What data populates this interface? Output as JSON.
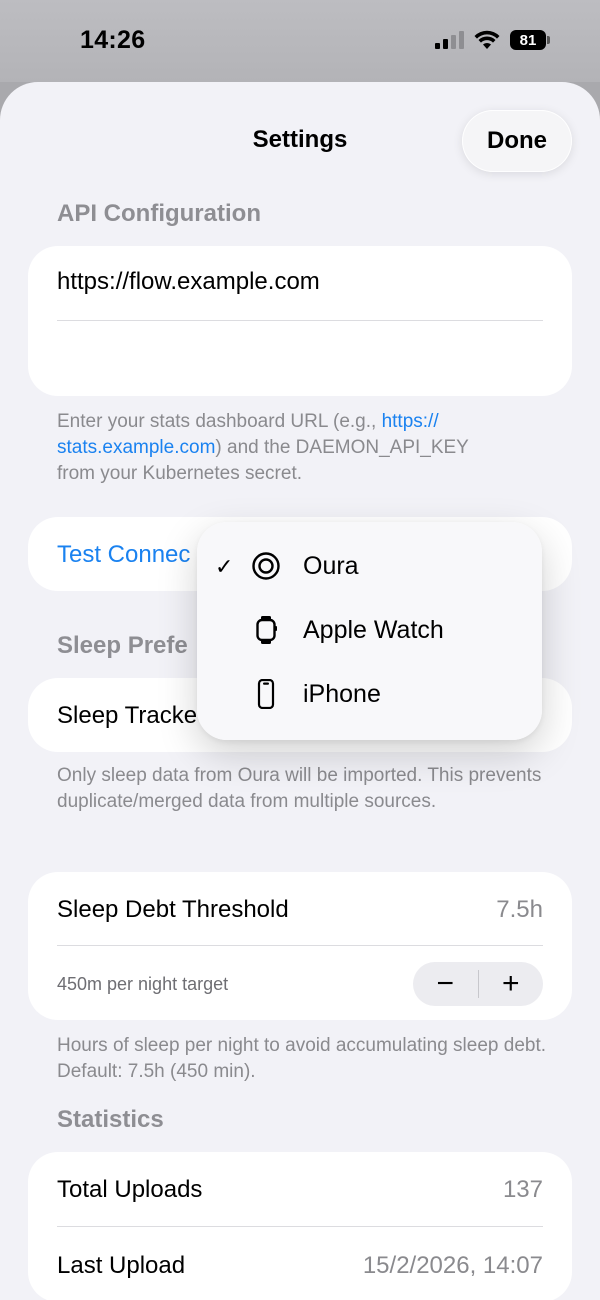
{
  "status_bar": {
    "time": "14:26",
    "battery": "81"
  },
  "nav": {
    "title": "Settings",
    "done": "Done"
  },
  "api": {
    "header": "API Configuration",
    "url_value": "https://flow.example.com",
    "api_key_value": "",
    "footer_prefix": "Enter your stats dashboard URL (e.g., ",
    "footer_link_1": "https://",
    "footer_link_2": "stats.example.com",
    "footer_suffix_1": ") and the DAEMON_API_KEY",
    "footer_suffix_2": "from your Kubernetes secret."
  },
  "test_connection": {
    "label": "Test Connec"
  },
  "sleep": {
    "header": "Sleep Prefe",
    "tracker_label": "Sleep Tracke",
    "footer": "Only sleep data from Oura will be imported. This prevents duplicate/merged data from multiple sources."
  },
  "sleep_tracker_menu": {
    "items": [
      {
        "label": "Oura",
        "icon": "oura-ring-icon",
        "selected": true
      },
      {
        "label": "Apple Watch",
        "icon": "apple-watch-icon",
        "selected": false
      },
      {
        "label": "iPhone",
        "icon": "iphone-icon",
        "selected": false
      }
    ],
    "check": "✓"
  },
  "threshold": {
    "label": "Sleep Debt Threshold",
    "value": "7.5h",
    "sub_label": "450m per night target",
    "minus": "−",
    "plus": "+",
    "footer": "Hours of sleep per night to avoid accumulating sleep debt. Default: 7.5h (450 min)."
  },
  "statistics": {
    "header": "Statistics",
    "rows": [
      {
        "label": "Total Uploads",
        "value": "137"
      },
      {
        "label": "Last Upload",
        "value": "15/2/2026, 14:07"
      }
    ]
  },
  "colors": {
    "accent": "#1a82f0",
    "secondary_text": "#8a8a8e",
    "background": "#f2f2f7"
  }
}
